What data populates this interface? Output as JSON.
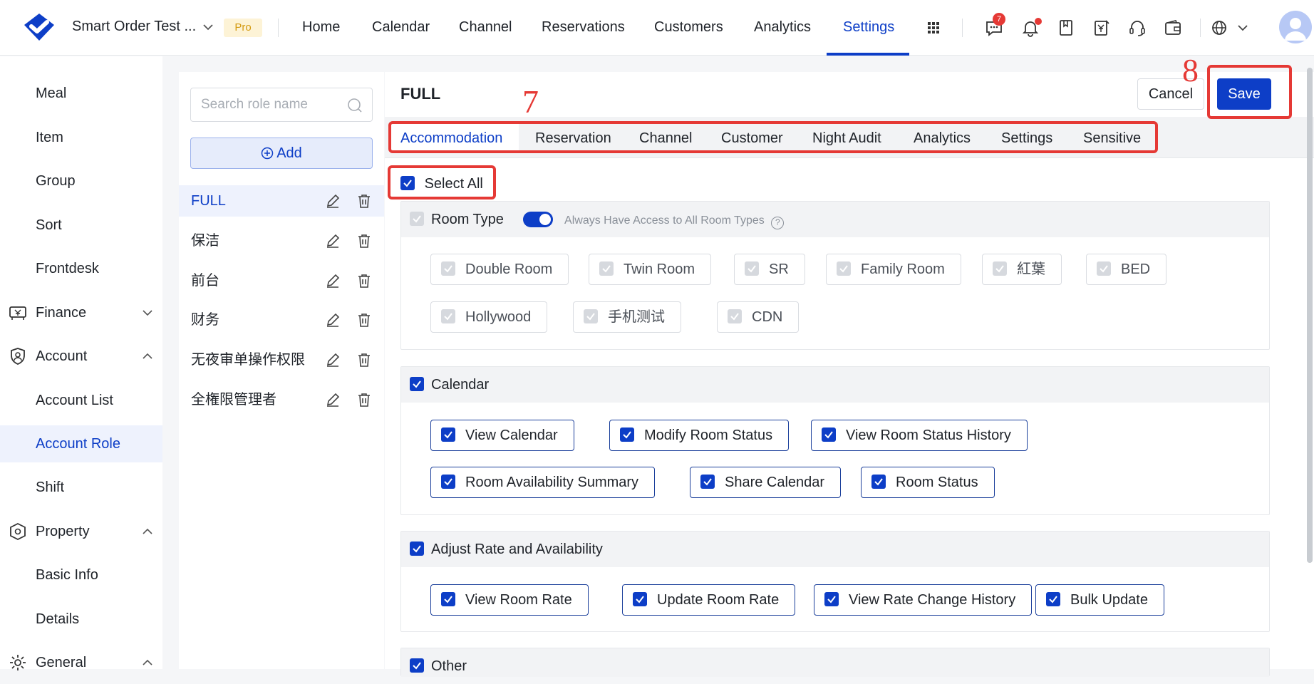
{
  "header": {
    "hotel_name": "Smart Order Test ...",
    "pro_badge": "Pro",
    "nav": [
      "Home",
      "Calendar",
      "Channel",
      "Reservations",
      "Customers",
      "Analytics",
      "Settings"
    ],
    "active_nav": "Settings",
    "message_badge": "7",
    "colors": {
      "accent": "#0d3ec7",
      "alert": "#e53935"
    }
  },
  "sidebar": {
    "items": [
      {
        "label": "Meal"
      },
      {
        "label": "Item"
      },
      {
        "label": "Group"
      },
      {
        "label": "Sort"
      },
      {
        "label": "Frontdesk"
      },
      {
        "label": "Finance",
        "group": true,
        "icon": "finance-icon",
        "expanded": false
      },
      {
        "label": "Account",
        "group": true,
        "icon": "shield-user-icon",
        "expanded": true
      },
      {
        "label": "Account List"
      },
      {
        "label": "Account Role",
        "active": true
      },
      {
        "label": "Shift"
      },
      {
        "label": "Property",
        "group": true,
        "icon": "property-icon",
        "expanded": true
      },
      {
        "label": "Basic Info"
      },
      {
        "label": "Details"
      },
      {
        "label": "General",
        "group": true,
        "icon": "gear-icon",
        "expanded": true
      }
    ]
  },
  "roles": {
    "search_placeholder": "Search role name",
    "add_label": "Add",
    "list": [
      "FULL",
      "保洁",
      "前台",
      "财务",
      "无夜审单操作权限",
      "全権限管理者"
    ],
    "active": "FULL"
  },
  "main": {
    "title": "FULL",
    "cancel_label": "Cancel",
    "save_label": "Save",
    "annotation_tabs": "7",
    "annotation_save": "8",
    "tabs": [
      "Accommodation",
      "Reservation",
      "Channel",
      "Customer",
      "Night Audit",
      "Analytics",
      "Settings",
      "Sensitive"
    ],
    "active_tab": "Accommodation",
    "select_all_label": "Select All",
    "sections": {
      "room_type": {
        "title": "Room Type",
        "toggle_label": "Always Have Access to All Room Types",
        "items": [
          "Double Room",
          "Twin Room",
          "SR",
          "Family Room",
          "紅葉",
          "BED",
          "Hollywood",
          "手机测试",
          "CDN"
        ]
      },
      "calendar": {
        "title": "Calendar",
        "items": [
          "View Calendar",
          "Modify Room Status",
          "View Room Status History",
          "Room Availability Summary",
          "Share Calendar",
          "Room Status"
        ]
      },
      "rate": {
        "title": "Adjust Rate and Availability",
        "items": [
          "View Room Rate",
          "Update Room Rate",
          "View Rate Change History",
          "Bulk Update"
        ]
      },
      "other": {
        "title": "Other"
      }
    }
  }
}
